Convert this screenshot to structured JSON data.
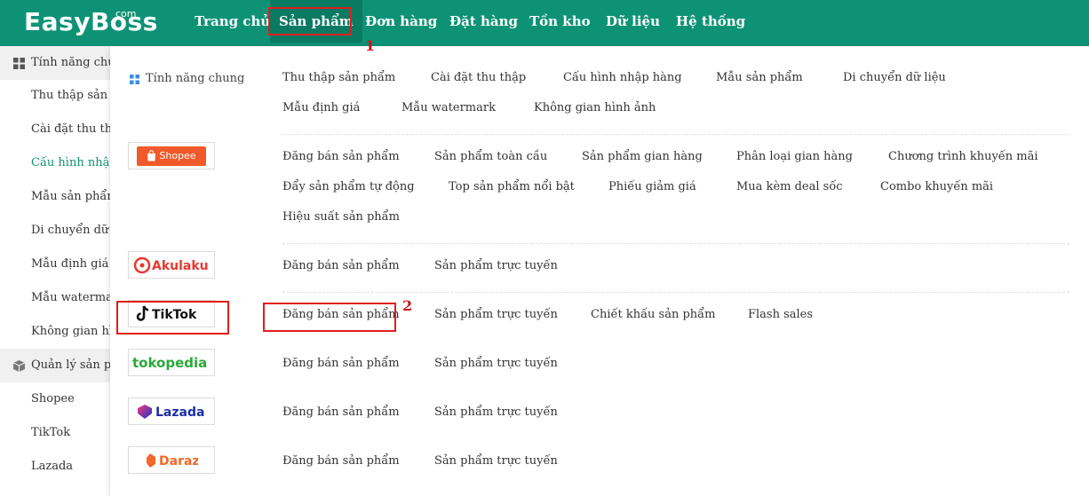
{
  "app": {
    "logo": "EasyBoss",
    "logo_suffix": "com"
  },
  "topnav": [
    {
      "label": "Trang chủ",
      "active": false
    },
    {
      "label": "Sản phẩm",
      "active": true
    },
    {
      "label": "Đơn hàng",
      "active": false
    },
    {
      "label": "Đặt hàng",
      "active": false
    },
    {
      "label": "Tồn kho",
      "active": false
    },
    {
      "label": "Dữ liệu",
      "active": false
    },
    {
      "label": "Hệ thống",
      "active": false
    }
  ],
  "sidebar": {
    "groups": [
      {
        "label": "Tính năng chung",
        "icon": "grid-icon",
        "items": [
          "Thu thập sản phẩm",
          "Cài đặt thu thập",
          "Cấu hình nhập hàng",
          "Mẫu sản phẩm",
          "Di chuyển dữ liệu",
          "Mẫu định giá",
          "Mẫu watermark",
          "Không gian hình ảnh"
        ],
        "active_item": "Cấu hình nhập hàng"
      },
      {
        "label": "Quản lý sản phẩm",
        "icon": "box-icon",
        "items": [
          "Shopee",
          "TikTok",
          "Lazada"
        ]
      }
    ]
  },
  "menu": {
    "general": {
      "title": "Tính năng chung",
      "links": [
        "Thu thập sản phẩm",
        "Cài đặt thu thập",
        "Cấu hình nhập hàng",
        "Mẫu sản phẩm",
        "Di chuyển dữ liệu",
        "Mẫu định giá",
        "Mẫu watermark",
        "Không gian hình ảnh"
      ]
    },
    "platforms": [
      {
        "name": "Shopee",
        "links": [
          "Đăng bán sản phẩm",
          "Sản phẩm toàn cầu",
          "Sản phẩm gian hàng",
          "Phân loại gian hàng",
          "Chương trình khuyến mãi",
          "Đẩy sản phẩm tự động",
          "Top sản phẩm nổi bật",
          "Phiếu giảm giá",
          "Mua kèm deal sốc",
          "Combo khuyến mãi",
          "Hiệu suất sản phẩm"
        ]
      },
      {
        "name": "Akulaku",
        "links": [
          "Đăng bán sản phẩm",
          "Sản phẩm trực tuyến"
        ]
      },
      {
        "name": "TikTok",
        "links": [
          "Đăng bán sản phẩm",
          "Sản phẩm trực tuyến",
          "Chiết khấu sản phẩm",
          "Flash sales"
        ]
      },
      {
        "name": "tokopedia",
        "links": [
          "Đăng bán sản phẩm",
          "Sản phẩm trực tuyến"
        ]
      },
      {
        "name": "Lazada",
        "links": [
          "Đăng bán sản phẩm",
          "Sản phẩm trực tuyến"
        ]
      },
      {
        "name": "Daraz",
        "links": [
          "Đăng bán sản phẩm",
          "Sản phẩm trực tuyến"
        ]
      }
    ]
  },
  "annotations": {
    "step1": "1",
    "step2": "2"
  },
  "colors": {
    "brand": "#0e9276",
    "annotation": "#e21d1d"
  }
}
